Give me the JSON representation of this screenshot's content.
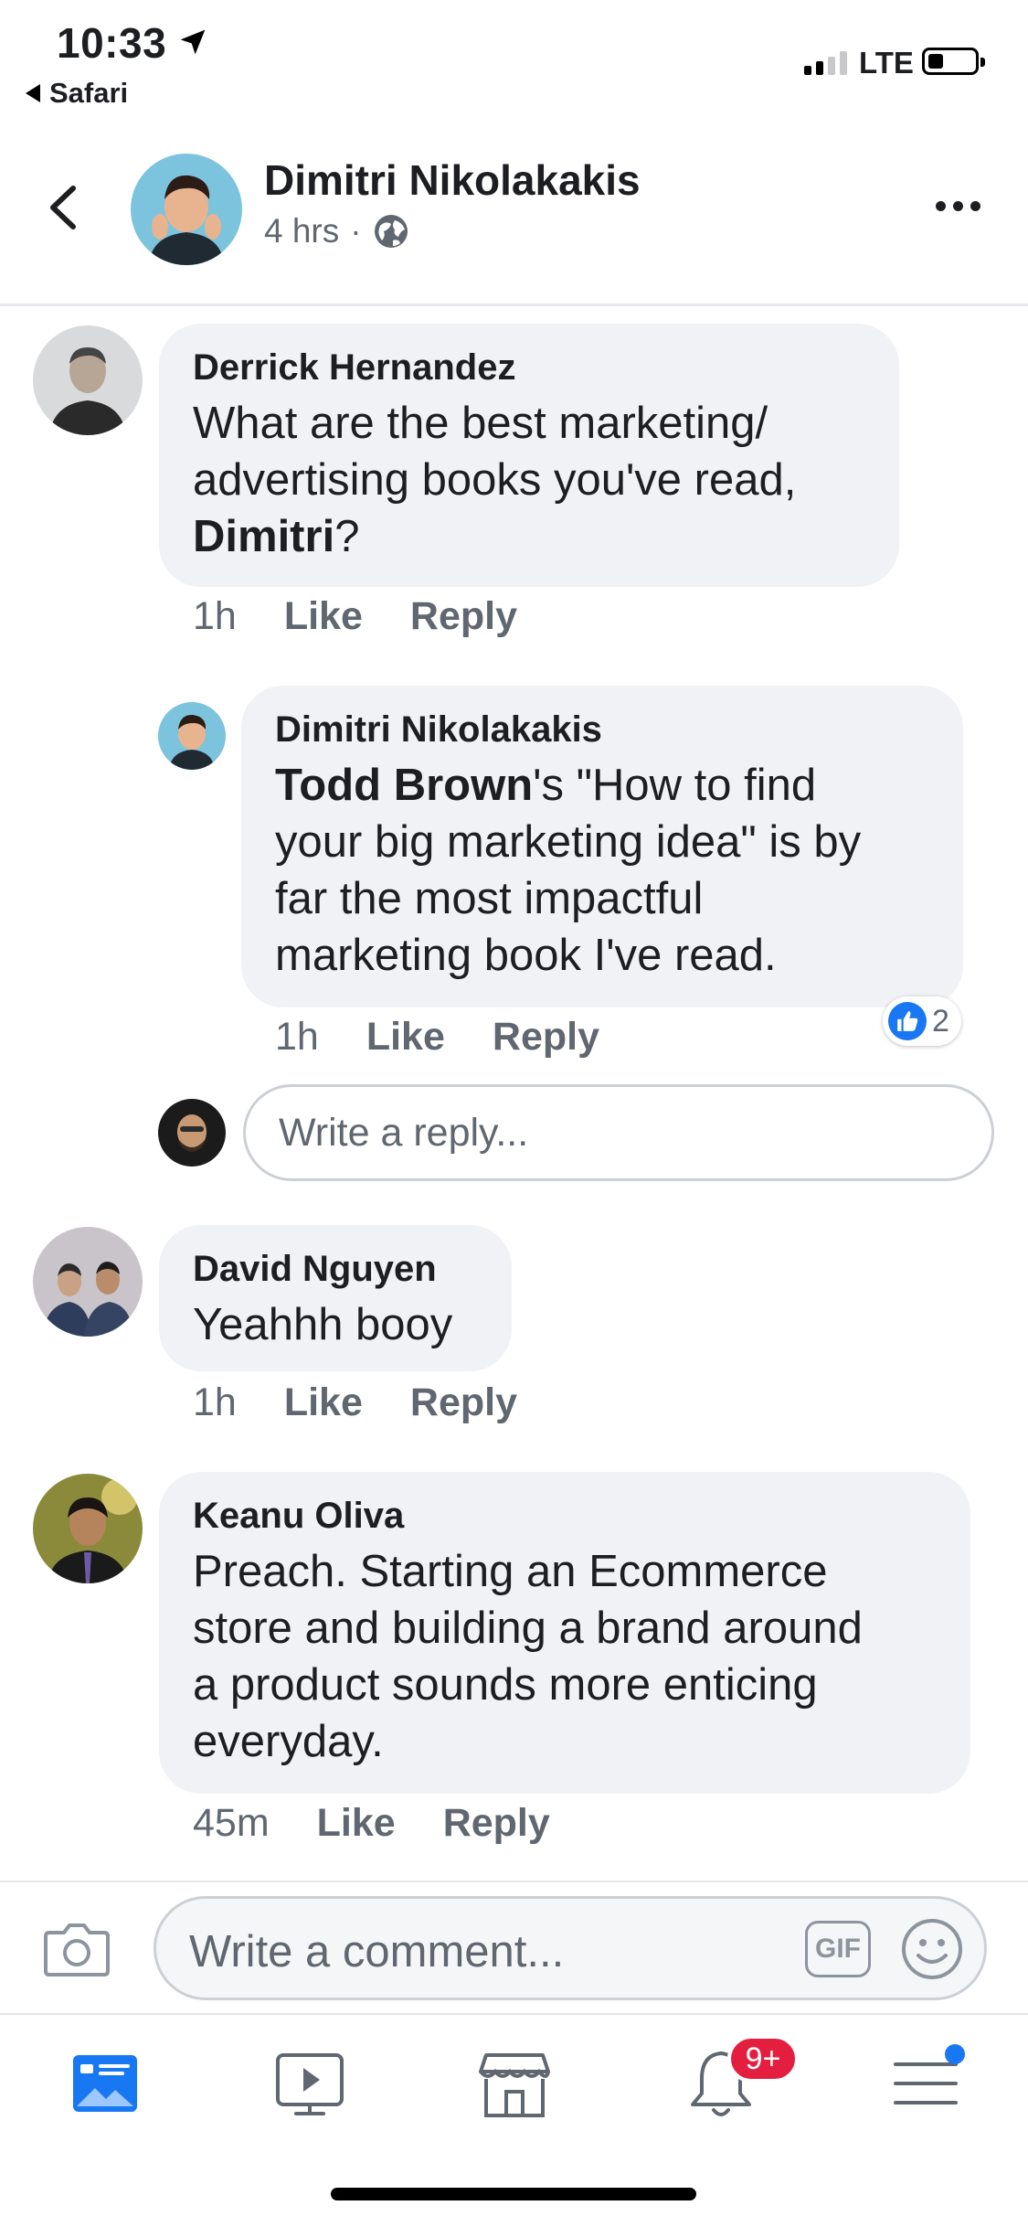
{
  "status_bar": {
    "time": "10:33",
    "back_app": "Safari",
    "network": "LTE",
    "icons": [
      "location-arrow-icon",
      "signal-icon",
      "battery-icon"
    ]
  },
  "post": {
    "author": "Dimitri Nikolakakis",
    "time": "4 hrs",
    "separator": "·",
    "privacy_icon": "globe-icon"
  },
  "comments": [
    {
      "author": "Derrick Hernandez",
      "text_lines": [
        "What are the best marketing/",
        "advertising books you've read,"
      ],
      "text_mention": "Dimitri",
      "text_tail": "?",
      "time": "1h",
      "like": "Like",
      "reply": "Reply"
    },
    {
      "author": "Dimitri Nikolakakis",
      "mention": "Todd Brown",
      "line1_rest": "'s \"How to find",
      "text_lines": [
        "your big marketing idea\" is by",
        "far the most impactful",
        "marketing book I've read."
      ],
      "time": "1h",
      "like": "Like",
      "reply": "Reply",
      "reaction_count": "2"
    },
    {
      "author": "David Nguyen",
      "text": "Yeahhh booy",
      "time": "1h",
      "like": "Like",
      "reply": "Reply"
    },
    {
      "author": "Keanu Oliva",
      "text_lines": [
        "Preach. Starting an Ecommerce",
        "store and building a brand around",
        "a product sounds more enticing",
        "everyday."
      ],
      "time": "45m",
      "like": "Like",
      "reply": "Reply"
    }
  ],
  "reply_input": {
    "placeholder": "Write a reply..."
  },
  "composer": {
    "placeholder": "Write a comment...",
    "gif_label": "GIF"
  },
  "tabbar": {
    "tabs": [
      "news-feed-icon",
      "watch-icon",
      "marketplace-icon",
      "notifications-icon",
      "menu-icon"
    ],
    "notification_badge": "9+"
  },
  "colors": {
    "accent": "#1877f2",
    "bubble": "#f0f2f5",
    "badge": "#e41e3f",
    "secondary_text": "#606770"
  }
}
